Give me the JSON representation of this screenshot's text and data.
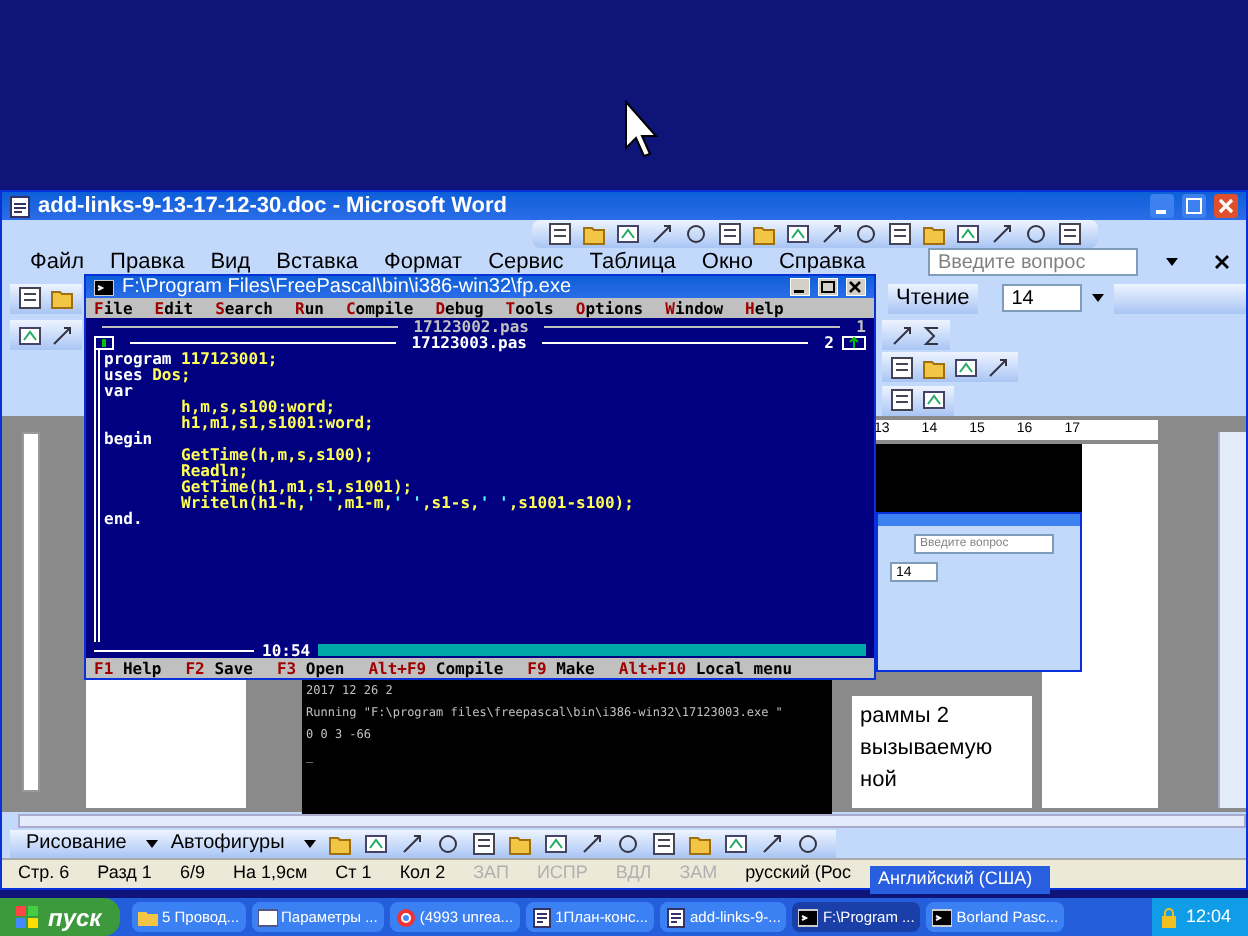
{
  "word": {
    "title": "add-links-9-13-17-12-30.doc - Microsoft Word",
    "menu": [
      "Файл",
      "Правка",
      "Вид",
      "Вставка",
      "Формат",
      "Сервис",
      "Таблица",
      "Окно",
      "Справка"
    ],
    "help_placeholder": "Введите вопрос",
    "reading_button": "Чтение",
    "font_size": "14",
    "ruler_numbers": [
      "13",
      "14",
      "15",
      "16",
      "17"
    ],
    "console_lines": [
      "2017 12 26 2",
      "Running \"F:\\program files\\freepascal\\bin\\i386-win32\\17123003.exe \"",
      "0 0 3 -66",
      "_"
    ],
    "document_lines": [
      "раммы 2",
      "вызываемую",
      "ной"
    ],
    "inner_window": {
      "help_placeholder": "Введите вопрос",
      "font_size": "14"
    },
    "drawing_toolbar": [
      "Рисование",
      "Автофигуры"
    ],
    "status_bar": [
      {
        "text": "Стр. 6",
        "disabled": false
      },
      {
        "text": "Разд 1",
        "disabled": false
      },
      {
        "text": "6/9",
        "disabled": false
      },
      {
        "text": "На 1,9см",
        "disabled": false
      },
      {
        "text": "Ст 1",
        "disabled": false
      },
      {
        "text": "Кол 2",
        "disabled": false
      },
      {
        "text": "ЗАП",
        "disabled": true
      },
      {
        "text": "ИСПР",
        "disabled": true
      },
      {
        "text": "ВДЛ",
        "disabled": true
      },
      {
        "text": "ЗАМ",
        "disabled": true
      },
      {
        "text": "русский (Рос",
        "disabled": false
      }
    ],
    "language_popup": "Английский (США)"
  },
  "fp": {
    "title": "F:\\Program Files\\FreePascal\\bin\\i386-win32\\fp.exe",
    "menu": [
      "File",
      "Edit",
      "Search",
      "Run",
      "Compile",
      "Debug",
      "Tools",
      "Options",
      "Window",
      "Help"
    ],
    "windows": [
      {
        "file": "17123002.pas",
        "number": "1",
        "selected": false
      },
      {
        "file": "17123003.pas",
        "number": "2",
        "selected": true
      }
    ],
    "code": [
      [
        {
          "text": "program",
          "kind": "keyword"
        },
        {
          "text": " 117123001;",
          "kind": "ident"
        }
      ],
      [
        {
          "text": "uses",
          "kind": "keyword"
        },
        {
          "text": " Dos;",
          "kind": "ident"
        }
      ],
      [
        {
          "text": "var",
          "kind": "keyword"
        }
      ],
      [
        {
          "text": "        h,m,s,s100:word;",
          "kind": "ident"
        }
      ],
      [
        {
          "text": "        h1,m1,s1,s1001:word;",
          "kind": "ident"
        }
      ],
      [
        {
          "text": "begin",
          "kind": "keyword"
        }
      ],
      [
        {
          "text": "        GetTime(h,m,s,s100);",
          "kind": "ident"
        }
      ],
      [
        {
          "text": "        Readln;",
          "kind": "ident"
        }
      ],
      [
        {
          "text": "        GetTime(h1,m1,s1,s1001);",
          "kind": "ident"
        }
      ],
      [
        {
          "text": "        Writeln(h1-h,",
          "kind": "ident"
        },
        {
          "text": "' '",
          "kind": "string"
        },
        {
          "text": ",m1-m,",
          "kind": "ident"
        },
        {
          "text": "' '",
          "kind": "string"
        },
        {
          "text": ",s1-s,",
          "kind": "ident"
        },
        {
          "text": "' '",
          "kind": "string"
        },
        {
          "text": ",s1001-s100);",
          "kind": "ident"
        }
      ],
      [
        {
          "text": "end.",
          "kind": "keyword"
        }
      ]
    ],
    "clock": "10:54",
    "hotkeys": [
      {
        "key": "F1",
        "label": "Help"
      },
      {
        "key": "F2",
        "label": "Save"
      },
      {
        "key": "F3",
        "label": "Open"
      },
      {
        "key": "Alt+F9",
        "label": "Compile"
      },
      {
        "key": "F9",
        "label": "Make"
      },
      {
        "key": "Alt+F10",
        "label": "Local menu"
      }
    ]
  },
  "taskbar": {
    "start": "пуск",
    "tasks": [
      {
        "label": "5 Провод...",
        "kind": "folder",
        "selected": false
      },
      {
        "label": "Параметры ...",
        "kind": "window",
        "selected": false
      },
      {
        "label": "(4993 unrea...",
        "kind": "browser",
        "selected": false
      },
      {
        "label": "1План-конс...",
        "kind": "document",
        "selected": false
      },
      {
        "label": "add-links-9-...",
        "kind": "document",
        "selected": false
      },
      {
        "label": "F:\\Program ...",
        "kind": "console",
        "selected": true
      },
      {
        "label": "Borland Pasc...",
        "kind": "console",
        "selected": false
      }
    ],
    "clock": "12:04"
  }
}
